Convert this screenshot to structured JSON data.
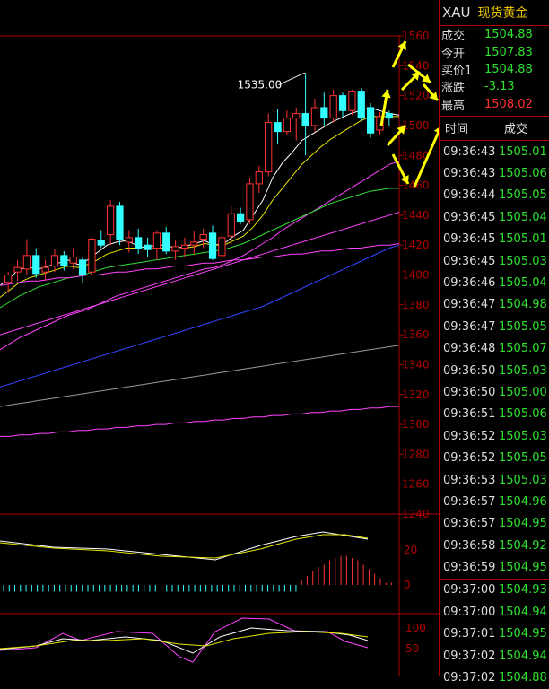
{
  "header": {
    "symbol": "XAU",
    "name": "现货黄金"
  },
  "quote": [
    {
      "label": "成交",
      "value": "1504.88",
      "color": "#2fe02f"
    },
    {
      "label": "今开",
      "value": "1507.83",
      "color": "#2fe02f"
    },
    {
      "label": "买价1",
      "value": "1504.88",
      "color": "#2fe02f"
    },
    {
      "label": "涨跌",
      "value": "-3.13",
      "color": "#2fe02f"
    },
    {
      "label": "最高",
      "value": "1508.02",
      "color": "#ff3333"
    }
  ],
  "trades_header": {
    "time": "时间",
    "price": "成交"
  },
  "trades": [
    {
      "time": "09:36:43",
      "price": "1505.01"
    },
    {
      "time": "09:36:43",
      "price": "1505.06"
    },
    {
      "time": "09:36:44",
      "price": "1505.05"
    },
    {
      "time": "09:36:45",
      "price": "1505.04"
    },
    {
      "time": "09:36:45",
      "price": "1505.01"
    },
    {
      "time": "09:36:45",
      "price": "1505.03"
    },
    {
      "time": "09:36:46",
      "price": "1505.04"
    },
    {
      "time": "09:36:47",
      "price": "1504.98"
    },
    {
      "time": "09:36:47",
      "price": "1505.05"
    },
    {
      "time": "09:36:48",
      "price": "1505.07"
    },
    {
      "time": "09:36:50",
      "price": "1505.03"
    },
    {
      "time": "09:36:50",
      "price": "1505.00"
    },
    {
      "time": "09:36:51",
      "price": "1505.06"
    },
    {
      "time": "09:36:52",
      "price": "1505.03"
    },
    {
      "time": "09:36:52",
      "price": "1505.05"
    },
    {
      "time": "09:36:53",
      "price": "1505.03"
    },
    {
      "time": "09:36:57",
      "price": "1504.96"
    },
    {
      "time": "09:36:57",
      "price": "1504.95"
    },
    {
      "time": "09:36:58",
      "price": "1504.92"
    },
    {
      "time": "09:36:59",
      "price": "1504.95"
    },
    {
      "time": "09:37:00",
      "price": "1504.93"
    },
    {
      "time": "09:37:00",
      "price": "1504.94"
    },
    {
      "time": "09:37:01",
      "price": "1504.95"
    },
    {
      "time": "09:37:02",
      "price": "1504.94"
    },
    {
      "time": "09:37:02",
      "price": "1504.88"
    }
  ],
  "chart_data": {
    "type": "candlestick",
    "price_axis": {
      "min": 1240,
      "max": 1560,
      "ticks": [
        1560,
        1540,
        1520,
        1500,
        1480,
        1460,
        1440,
        1420,
        1400,
        1380,
        1360,
        1340,
        1320,
        1300,
        1280,
        1260,
        1240
      ]
    },
    "max_label": "1535.00",
    "candles": [
      {
        "o": 1395,
        "h": 1402,
        "l": 1388,
        "c": 1400
      },
      {
        "o": 1402,
        "h": 1410,
        "l": 1396,
        "c": 1405
      },
      {
        "o": 1404,
        "h": 1424,
        "l": 1400,
        "c": 1413
      },
      {
        "o": 1413,
        "h": 1418,
        "l": 1398,
        "c": 1401
      },
      {
        "o": 1402,
        "h": 1410,
        "l": 1396,
        "c": 1405
      },
      {
        "o": 1406,
        "h": 1417,
        "l": 1402,
        "c": 1413
      },
      {
        "o": 1413,
        "h": 1416,
        "l": 1403,
        "c": 1406
      },
      {
        "o": 1408,
        "h": 1418,
        "l": 1404,
        "c": 1412
      },
      {
        "o": 1410,
        "h": 1412,
        "l": 1395,
        "c": 1400
      },
      {
        "o": 1402,
        "h": 1425,
        "l": 1400,
        "c": 1424
      },
      {
        "o": 1423,
        "h": 1430,
        "l": 1418,
        "c": 1420
      },
      {
        "o": 1427,
        "h": 1450,
        "l": 1420,
        "c": 1446
      },
      {
        "o": 1446,
        "h": 1449,
        "l": 1420,
        "c": 1424
      },
      {
        "o": 1422,
        "h": 1430,
        "l": 1415,
        "c": 1425
      },
      {
        "o": 1425,
        "h": 1431,
        "l": 1414,
        "c": 1418
      },
      {
        "o": 1420,
        "h": 1425,
        "l": 1412,
        "c": 1417
      },
      {
        "o": 1418,
        "h": 1430,
        "l": 1410,
        "c": 1428
      },
      {
        "o": 1428,
        "h": 1432,
        "l": 1414,
        "c": 1416
      },
      {
        "o": 1416,
        "h": 1423,
        "l": 1410,
        "c": 1419
      },
      {
        "o": 1418,
        "h": 1425,
        "l": 1412,
        "c": 1420
      },
      {
        "o": 1420,
        "h": 1429,
        "l": 1414,
        "c": 1422
      },
      {
        "o": 1424,
        "h": 1431,
        "l": 1418,
        "c": 1427
      },
      {
        "o": 1428,
        "h": 1433,
        "l": 1410,
        "c": 1411
      },
      {
        "o": 1413,
        "h": 1428,
        "l": 1400,
        "c": 1425
      },
      {
        "o": 1426,
        "h": 1446,
        "l": 1420,
        "c": 1441
      },
      {
        "o": 1441,
        "h": 1445,
        "l": 1434,
        "c": 1436
      },
      {
        "o": 1437,
        "h": 1465,
        "l": 1434,
        "c": 1461
      },
      {
        "o": 1461,
        "h": 1473,
        "l": 1455,
        "c": 1469
      },
      {
        "o": 1469,
        "h": 1508,
        "l": 1466,
        "c": 1502
      },
      {
        "o": 1502,
        "h": 1511,
        "l": 1488,
        "c": 1496
      },
      {
        "o": 1496,
        "h": 1510,
        "l": 1494,
        "c": 1505
      },
      {
        "o": 1505,
        "h": 1512,
        "l": 1490,
        "c": 1508
      },
      {
        "o": 1508,
        "h": 1535,
        "l": 1480,
        "c": 1500
      },
      {
        "o": 1500,
        "h": 1518,
        "l": 1496,
        "c": 1512
      },
      {
        "o": 1512,
        "h": 1522,
        "l": 1500,
        "c": 1505
      },
      {
        "o": 1505,
        "h": 1524,
        "l": 1502,
        "c": 1520
      },
      {
        "o": 1520,
        "h": 1522,
        "l": 1506,
        "c": 1510
      },
      {
        "o": 1510,
        "h": 1524,
        "l": 1507,
        "c": 1523
      },
      {
        "o": 1523,
        "h": 1525,
        "l": 1503,
        "c": 1505
      },
      {
        "o": 1512,
        "h": 1515,
        "l": 1492,
        "c": 1495
      },
      {
        "o": 1497,
        "h": 1509,
        "l": 1494,
        "c": 1506
      },
      {
        "o": 1508,
        "h": 1510,
        "l": 1500,
        "c": 1505
      }
    ],
    "ma_lines": [
      {
        "color": "#ffffff",
        "values": [
          1393,
          1398,
          1404,
          1405,
          1404,
          1406,
          1408,
          1410,
          1407,
          1410,
          1415,
          1420,
          1422,
          1423,
          1420,
          1418,
          1420,
          1420,
          1418,
          1419,
          1421,
          1423,
          1420,
          1421,
          1426,
          1430,
          1440,
          1450,
          1465,
          1475,
          1482,
          1490,
          1494,
          1498,
          1502,
          1505,
          1508,
          1510,
          1512,
          1510,
          1508,
          1507
        ]
      },
      {
        "color": "#e6e600",
        "values": [
          1385,
          1390,
          1395,
          1398,
          1400,
          1402,
          1404,
          1406,
          1405,
          1407,
          1410,
          1414,
          1416,
          1418,
          1418,
          1417,
          1418,
          1418,
          1417,
          1418,
          1419,
          1421,
          1420,
          1420,
          1423,
          1426,
          1432,
          1440,
          1450,
          1458,
          1466,
          1474,
          1480,
          1486,
          1491,
          1495,
          1499,
          1503,
          1506,
          1506,
          1506,
          1506
        ]
      },
      {
        "color": "#ff44ff",
        "values": [
          1350,
          1354,
          1358,
          1361,
          1364,
          1367,
          1370,
          1373,
          1375,
          1377,
          1380,
          1383,
          1386,
          1388,
          1390,
          1392,
          1394,
          1396,
          1398,
          1400,
          1402,
          1404,
          1405,
          1407,
          1410,
          1413,
          1417,
          1421,
          1425,
          1430,
          1434,
          1438,
          1442,
          1446,
          1450,
          1454,
          1458,
          1462,
          1466,
          1470,
          1474,
          1476
        ]
      },
      {
        "color": "#33dd33",
        "values": [
          1378,
          1382,
          1386,
          1389,
          1392,
          1394,
          1396,
          1398,
          1399,
          1401,
          1403,
          1405,
          1406,
          1407,
          1408,
          1409,
          1410,
          1411,
          1412,
          1413,
          1414,
          1415,
          1416,
          1417,
          1419,
          1421,
          1424,
          1427,
          1430,
          1433,
          1436,
          1439,
          1442,
          1445,
          1448,
          1450,
          1452,
          1454,
          1456,
          1457,
          1458,
          1458
        ]
      },
      {
        "color": "#ff44ff",
        "values": [
          1360,
          1362,
          1364,
          1366,
          1368,
          1370,
          1372,
          1374,
          1376,
          1378,
          1380,
          1382,
          1384,
          1386,
          1388,
          1390,
          1392,
          1394,
          1396,
          1398,
          1400,
          1402,
          1404,
          1406,
          1408,
          1410,
          1412,
          1414,
          1416,
          1418,
          1420,
          1422,
          1424,
          1426,
          1428,
          1430,
          1432,
          1434,
          1436,
          1438,
          1440,
          1442
        ]
      },
      {
        "color": "#ff44ff",
        "values": [
          1393,
          1394,
          1395,
          1396,
          1396,
          1397,
          1398,
          1398,
          1399,
          1400,
          1400,
          1401,
          1402,
          1402,
          1403,
          1404,
          1404,
          1405,
          1406,
          1406,
          1407,
          1408,
          1408,
          1409,
          1410,
          1410,
          1411,
          1412,
          1412,
          1413,
          1414,
          1414,
          1415,
          1416,
          1416,
          1417,
          1418,
          1418,
          1419,
          1420,
          1420,
          1421
        ]
      },
      {
        "color": "#3344ff",
        "values": [
          1325,
          1327,
          1329,
          1331,
          1333,
          1335,
          1337,
          1339,
          1341,
          1343,
          1345,
          1347,
          1349,
          1351,
          1353,
          1355,
          1357,
          1359,
          1361,
          1363,
          1365,
          1367,
          1369,
          1371,
          1373,
          1375,
          1377,
          1379,
          1382,
          1385,
          1388,
          1391,
          1394,
          1397,
          1400,
          1403,
          1406,
          1409,
          1412,
          1415,
          1418,
          1420
        ]
      },
      {
        "color": "#999999",
        "values": [
          1312,
          1313,
          1314,
          1315,
          1316,
          1317,
          1318,
          1319,
          1320,
          1321,
          1322,
          1323,
          1324,
          1325,
          1326,
          1327,
          1328,
          1329,
          1330,
          1331,
          1332,
          1333,
          1334,
          1335,
          1336,
          1337,
          1338,
          1339,
          1340,
          1341,
          1342,
          1343,
          1344,
          1345,
          1346,
          1347,
          1348,
          1349,
          1350,
          1351,
          1352,
          1353
        ]
      },
      {
        "color": "#ff44ff",
        "values": [
          1292,
          1292,
          1293,
          1293,
          1294,
          1294,
          1295,
          1295,
          1296,
          1296,
          1297,
          1297,
          1298,
          1298,
          1299,
          1299,
          1300,
          1300,
          1301,
          1301,
          1302,
          1302,
          1303,
          1303,
          1304,
          1304,
          1305,
          1305,
          1306,
          1306,
          1307,
          1307,
          1308,
          1308,
          1309,
          1309,
          1310,
          1310,
          1311,
          1311,
          1312,
          1312
        ]
      }
    ],
    "macd_axis": {
      "ticks": [
        20,
        0
      ]
    },
    "macd_hist": [
      -3,
      -3,
      -3,
      -3,
      -3,
      -3,
      -3,
      -3,
      -3,
      -3,
      -3,
      -3,
      -3,
      -3,
      -3,
      -3,
      -3,
      -3,
      -3,
      -3,
      -3,
      -3,
      -3,
      -3,
      -3,
      -3,
      -3,
      -3,
      -3,
      -3,
      -3,
      -3,
      -3,
      -3,
      -3,
      -3,
      -3,
      -3,
      -3,
      -3,
      -3,
      -3,
      -3,
      -3,
      -3,
      -3,
      -3,
      -3,
      -3,
      -3,
      -3,
      -3,
      -3,
      2,
      4,
      6,
      8,
      9,
      11,
      12,
      13,
      13,
      12,
      11,
      9,
      7,
      5,
      3,
      1,
      1,
      1
    ],
    "kdj_axis": {
      "ticks": [
        100,
        50
      ]
    }
  }
}
